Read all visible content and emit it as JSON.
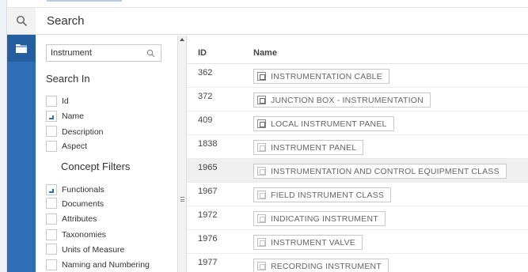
{
  "header": {
    "title": "Search"
  },
  "rail": {
    "icons": [
      "search-icon",
      "folder-icon"
    ]
  },
  "filters": {
    "search_value": "Instrument",
    "search_in_title": "Search In",
    "search_in": [
      {
        "label": "Id",
        "checked": false
      },
      {
        "label": "Name",
        "checked": true
      },
      {
        "label": "Description",
        "checked": false
      },
      {
        "label": "Aspect",
        "checked": false
      }
    ],
    "concept_filters_title": "Concept Filters",
    "concept_filters": [
      {
        "label": "Functionals",
        "checked": true
      },
      {
        "label": "Documents",
        "checked": false
      },
      {
        "label": "Attributes",
        "checked": false
      },
      {
        "label": "Taxonomies",
        "checked": false
      },
      {
        "label": "Units of Measure",
        "checked": false
      },
      {
        "label": "Naming and Numbering",
        "checked": false
      }
    ]
  },
  "results": {
    "columns": {
      "id": "ID",
      "name": "Name"
    },
    "rows": [
      {
        "id": "362",
        "name": "INSTRUMENTATION CABLE",
        "icon": "item-icon",
        "selected": false
      },
      {
        "id": "372",
        "name": "JUNCTION BOX - INSTRUMENTATION",
        "icon": "item-icon",
        "selected": false
      },
      {
        "id": "409",
        "name": "LOCAL INSTRUMENT PANEL",
        "icon": "item-icon",
        "selected": false
      },
      {
        "id": "1838",
        "name": "INSTRUMENT PANEL",
        "icon": "class-icon",
        "selected": false
      },
      {
        "id": "1965",
        "name": "INSTRUMENTATION AND CONTROL EQUIPMENT CLASS",
        "icon": "class-icon",
        "selected": true
      },
      {
        "id": "1967",
        "name": "FIELD INSTRUMENT CLASS",
        "icon": "class-icon",
        "selected": false
      },
      {
        "id": "1972",
        "name": "INDICATING INSTRUMENT",
        "icon": "class-icon",
        "selected": false
      },
      {
        "id": "1976",
        "name": "INSTRUMENT VALVE",
        "icon": "class-icon",
        "selected": false
      },
      {
        "id": "1977",
        "name": "RECORDING INSTRUMENT",
        "icon": "class-icon",
        "selected": false
      }
    ]
  }
}
